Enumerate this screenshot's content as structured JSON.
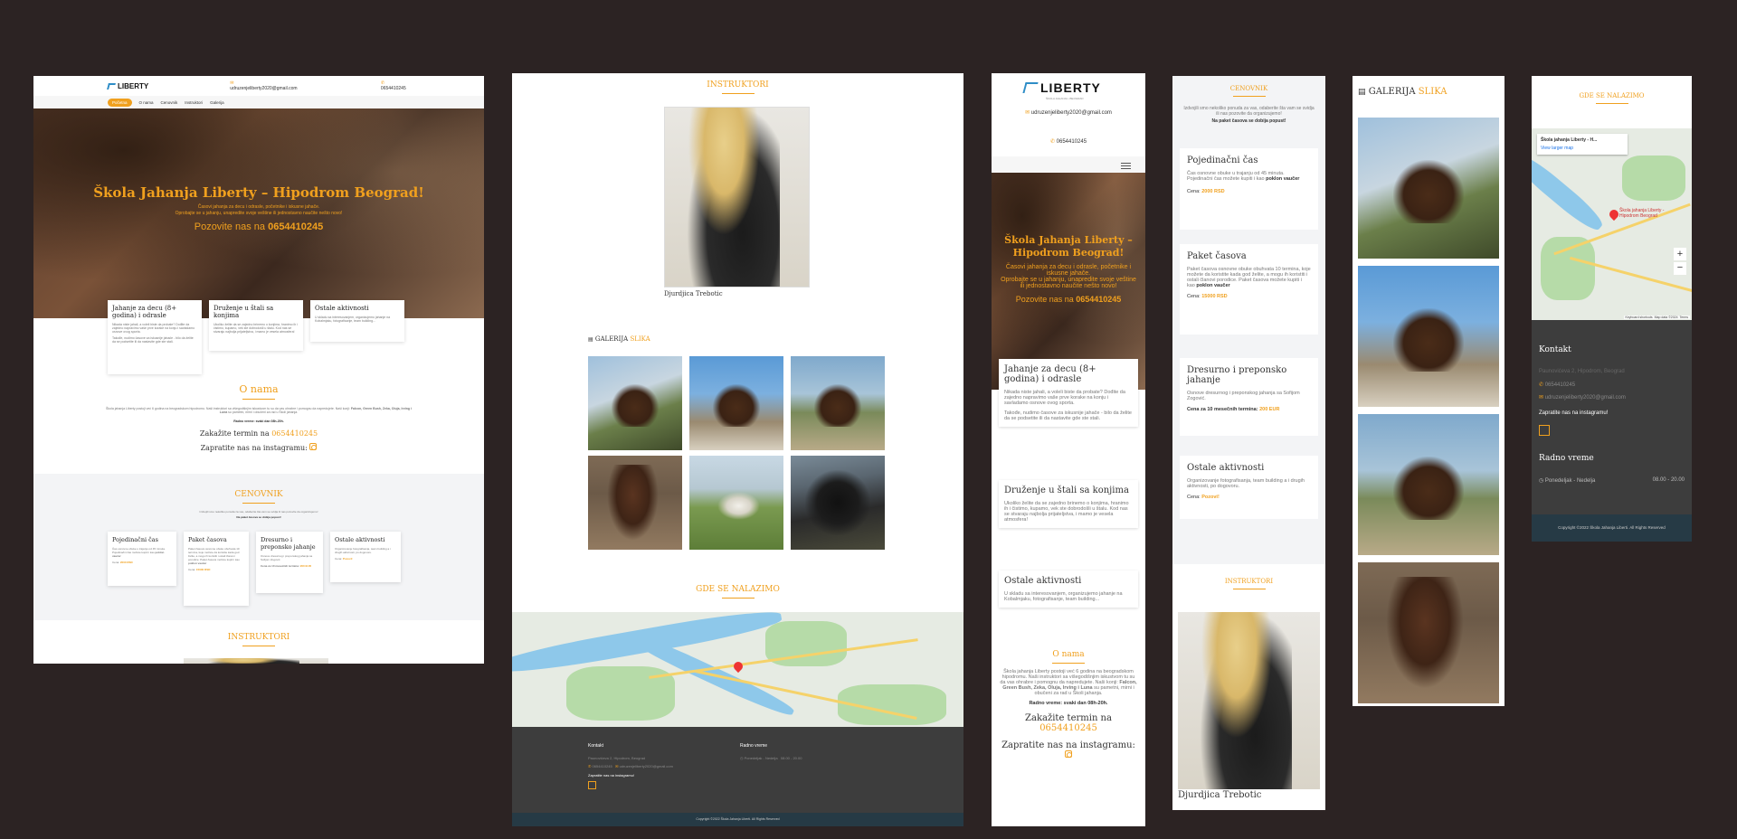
{
  "brand": {
    "name": "LIBERTY",
    "sub": "ŠKOLA JAHANJA • BEOGRAD",
    "email": "udruzenjeliberty2020@gmail.com",
    "phone": "0654410245"
  },
  "nav": [
    "Početna",
    "O nama",
    "Cenovnik",
    "Instruktori",
    "Galerija"
  ],
  "hero": {
    "title": "Škola Jahanja Liberty – Hipodrom Beograd!",
    "line1": "Časovi jahanja za decu i odrasle, početnike i iskusne jahače.",
    "line2": "Oprobajte se u jahanju, unapredite svoje veštine ili jednostavno naučite nešto novo!",
    "call_prefix": "Pozovite nas na",
    "call_number": "0654410245"
  },
  "services": [
    {
      "title": "Jahanje za decu (8+ godina) i odrasle",
      "text": "Nikada niste jahali, a voleli biste da probate? Dođite da zajedno napravimo vaše prve korake na konju i savladamo osnove ovog sporta.",
      "text2": "Takođe, nudimo časove za iskusnije jahače - bilo da želite da se podsetite ili da nastavite gde ste stali."
    },
    {
      "title": "Druženje u štali sa konjima",
      "text": "Ukoliko želite da se zajedno brinemo o konjima, hranimo ih i čistimo, kupamo, vek ste dobrodošli u štalu. Kod nas se stvaraju najbolja prijateljstva, i mamo je vesela atmosfera!"
    },
    {
      "title": "Ostale aktivnosti",
      "text": "U skladu sa interesovanjem, organizujemo jahanje na Kobalmjaku, fotografisanje, team building..."
    }
  ],
  "about": {
    "title": "O nama",
    "text": "Škola jahanja Liberty postoji već 6 godina na beogradskom hipodromu. Naši instruktori sa višegodišnjim iskustvom tu su da vas ohrabre i pomognu da napredujete. Naši konji:",
    "horses": "Falcon, Green Bush, Zeka, Oluja, Irving i Luna",
    "text_end": "su pametni, mirni i obučeni za rad u Školi jahanja.",
    "hours": "Radno vreme: svaki dan 08h-20h.",
    "book_prefix": "Zakažite termin na",
    "book_number": "0654410245",
    "insta_text": "Zapratite nas na instagramu:"
  },
  "pricing": {
    "title": "CENOVNIK",
    "intro": "Izdvojili smo nekoliko ponuda za vas, odaberite šta vam se svidja ili nas pozovite da organizujemo!",
    "intro_bold": "Na paket časova se dobija popust!",
    "price_label": "Cena:",
    "items": [
      {
        "title": "Pojedinačni čas",
        "text": "Čas osnovne obuke u trajanju od 45 minuta. Pojedinačni čas možete kupiti i kao",
        "bold": "poklon vaučer",
        "price": "2000 RSD"
      },
      {
        "title": "Paket časova",
        "text": "Paket časova osnovne obuke obuhvata 10 termina, koje možete da koristite kada god želite, a mogu ih koristiti i ostali članovi porodice. Paket časova možete kupiti i kao",
        "bold": "poklon vaučer",
        "price": "15000 RSD"
      },
      {
        "title": "Dresurno i preponsko jahanje",
        "text": "Osnove dresurnog i preponskog jahanja sa Sofijom Zogović.",
        "price_full": "Cena za 10 mesečnih termina:",
        "price": "200 EUR"
      },
      {
        "title": "Ostale aktivnosti",
        "text": "Organizovanje fotografisanja, team building a i drugih aktivnosti, po dogovoru.",
        "price": "Pozovi!"
      }
    ]
  },
  "instructors": {
    "title": "INSTRUKTORI",
    "name": "Djurdjica Trebotic"
  },
  "gallery": {
    "title_a": "GALERIJA",
    "title_b": "SLIKA"
  },
  "location": {
    "title": "GDE SE NALAZIMO",
    "place": "Škola jahanja Liberty - Hipodrom Beograd",
    "place_short": "Škola jahanja Liberty - H...",
    "view_larger": "View larger map",
    "shortcuts": "Keyboard shortcuts",
    "map_data": "Map data ©2024",
    "terms": "Terms"
  },
  "footer": {
    "contact_title": "Kontakt",
    "address": "Paunovićeva 2, Hipodrom, Beograd",
    "insta_text": "Zapratite nas na instagramu!",
    "hours_title": "Radno vreme",
    "days": "Ponedeljak - Nedelja",
    "time": "08.00 - 20.00",
    "copyright": "Copyright ©2022 Škola Jahanja Liberti. All Rights Reserved"
  },
  "colors": {
    "accent": "#f0a01e",
    "background": "#2c2323",
    "footer": "#3d3d3d"
  }
}
